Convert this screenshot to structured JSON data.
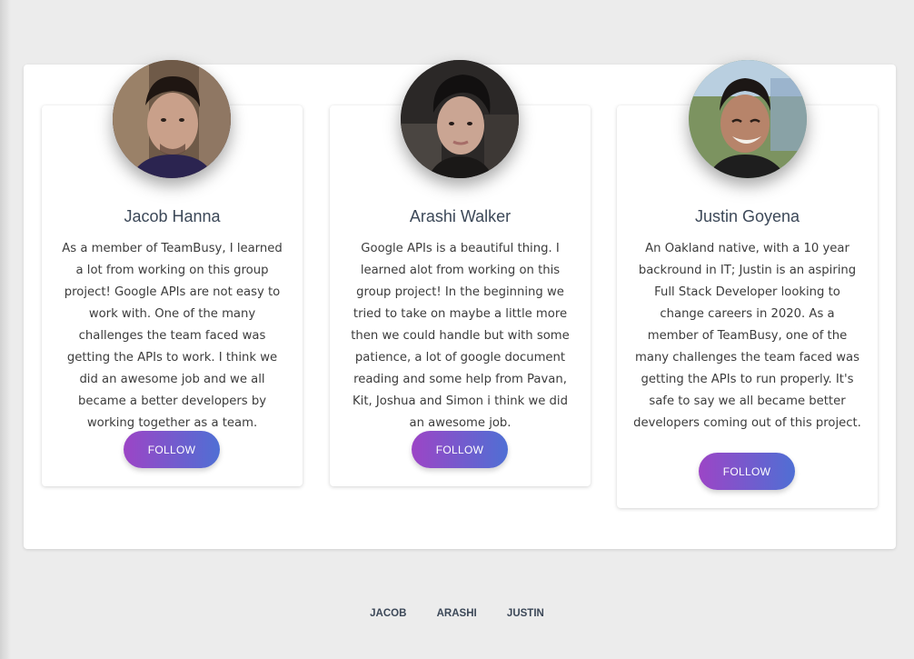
{
  "team": [
    {
      "name": "Jacob Hanna",
      "bio": "As a member of TeamBusy, I learned a lot from working on this group project! Google APIs are not easy to work with. One of the many challenges the team faced was getting the APIs to work. I think we did an awesome job and we all became a better developers by working together as a team.",
      "follow_label": "FOLLOW",
      "avatar_alt": "Jacob Hanna profile photo"
    },
    {
      "name": "Arashi Walker",
      "bio": "Google APIs is a beautiful thing. I learned alot from working on this group project! In the beginning we tried to take on maybe a little more then we could handle but with some patience, a lot of google document reading and some help from Pavan, Kit, Joshua and Simon i think we did an awesome job.",
      "follow_label": "FOLLOW",
      "avatar_alt": "Arashi Walker profile photo"
    },
    {
      "name": "Justin Goyena",
      "bio": "An Oakland native, with a 10 year backround in IT; Justin is an aspiring Full Stack Developer looking to change careers in 2020. As a member of TeamBusy, one of the many challenges the team faced was getting the APIs to run properly. It's safe to say we all became better developers coming out of this project.",
      "follow_label": "FOLLOW",
      "avatar_alt": "Justin Goyena profile photo"
    }
  ],
  "footer_nav": [
    "JACOB",
    "ARASHI",
    "JUSTIN"
  ],
  "colors": {
    "button_gradient_start": "#9c45c6",
    "button_gradient_end": "#4f6fd4",
    "name_color": "#3c4858"
  }
}
